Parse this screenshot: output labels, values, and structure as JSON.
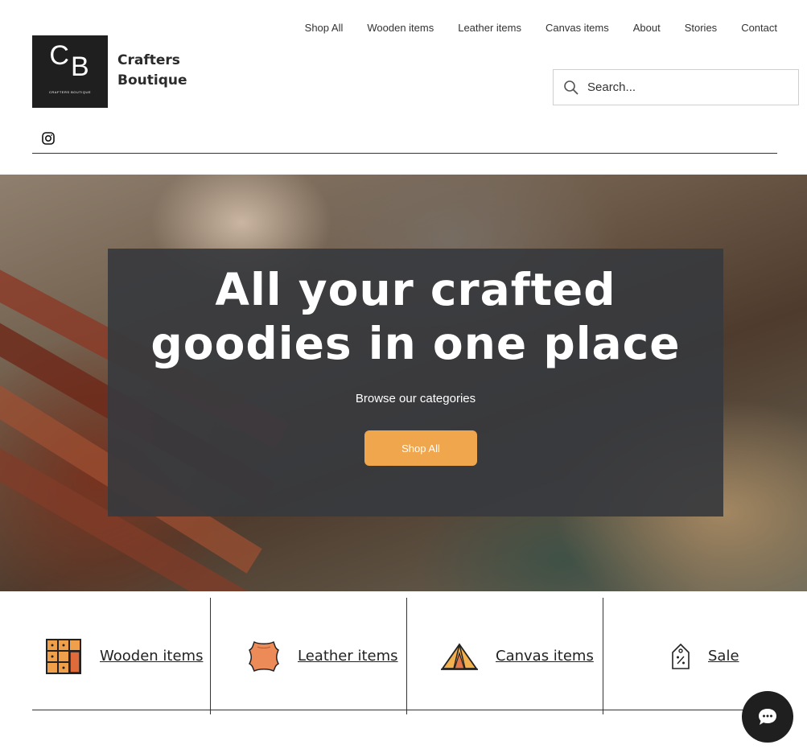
{
  "brand": {
    "logo_letters_c": "C",
    "logo_letters_b": "B",
    "logo_small": "CRAFTERS BOUTIQUE",
    "name": "Crafters Boutique"
  },
  "nav": {
    "items": [
      {
        "label": "Shop All"
      },
      {
        "label": "Wooden items"
      },
      {
        "label": "Leather items"
      },
      {
        "label": "Canvas items"
      },
      {
        "label": "About"
      },
      {
        "label": "Stories"
      },
      {
        "label": "Contact"
      }
    ]
  },
  "search": {
    "placeholder": "Search..."
  },
  "social": {
    "icon": "instagram-icon"
  },
  "hero": {
    "title": "All your crafted goodies in one place",
    "subtitle": "Browse our categories",
    "button_label": "Shop All",
    "button_color": "#f0a64d"
  },
  "categories": [
    {
      "label": "Wooden items",
      "icon": "wooden-crate-icon"
    },
    {
      "label": "Leather items",
      "icon": "leather-hide-icon"
    },
    {
      "label": "Canvas items",
      "icon": "tent-icon"
    },
    {
      "label": "Sale",
      "icon": "price-tag-icon"
    }
  ],
  "chat": {
    "icon": "chat-bubble-icon"
  }
}
